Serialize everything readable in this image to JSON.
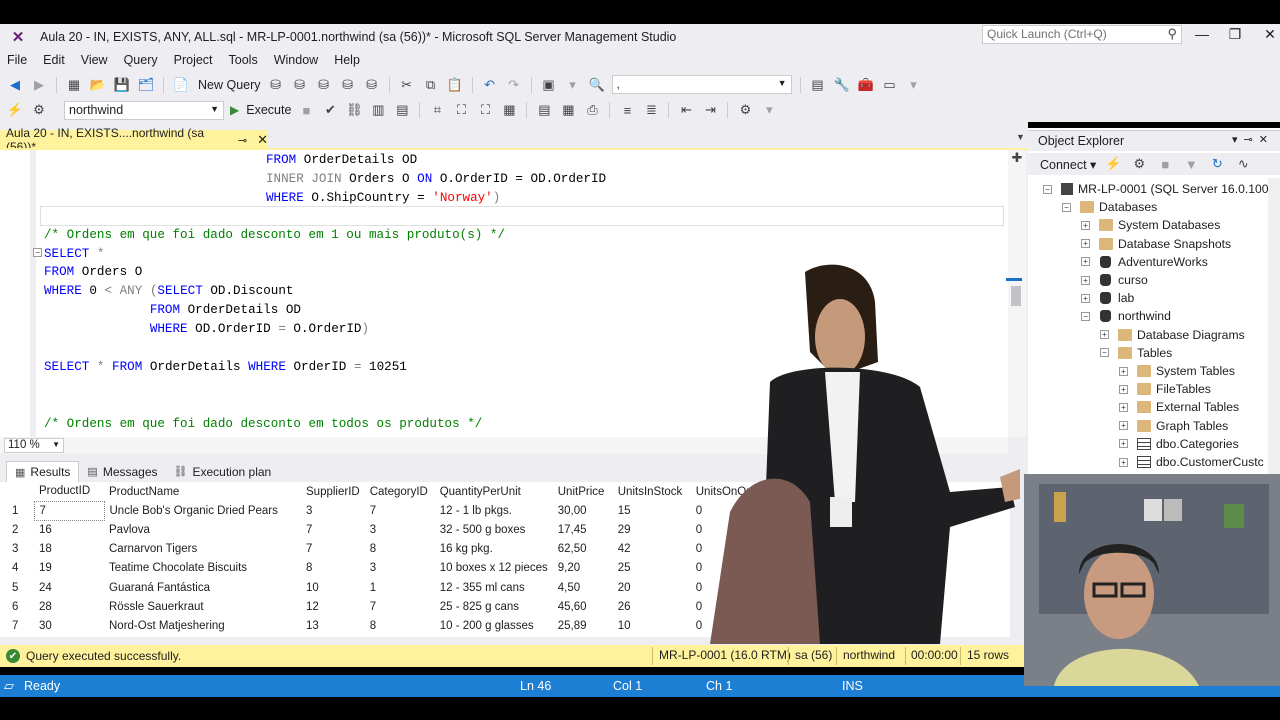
{
  "window": {
    "title": "Aula 20 - IN, EXISTS, ANY, ALL.sql - MR-LP-0001.northwind (sa (56))* - Microsoft SQL Server Management Studio",
    "quick_launch_placeholder": "Quick Launch (Ctrl+Q)"
  },
  "menu": [
    "File",
    "Edit",
    "View",
    "Query",
    "Project",
    "Tools",
    "Window",
    "Help"
  ],
  "toolbar": {
    "new_query_label": "New Query",
    "database": "northwind",
    "execute_label": "Execute",
    "search_combo_value": ","
  },
  "document_tab": {
    "label": "Aula 20 - IN, EXISTS....northwind (sa (56))*",
    "pin": "⊸",
    "close": "✕"
  },
  "editor": {
    "zoom": "110 %",
    "lines": [
      [
        "            ",
        [
          "kw",
          "FROM"
        ],
        " OrderDetails OD"
      ],
      [
        "            ",
        [
          "gr",
          "INNER JOIN"
        ],
        " Orders O ",
        [
          "kw",
          "ON"
        ],
        " O.OrderID = OD.OrderID"
      ],
      [
        "            ",
        [
          "kw",
          "WHERE"
        ],
        " O.ShipCountry = ",
        [
          "str",
          "'Norway'"
        ],
        [
          "gr",
          ")"
        ]
      ],
      [
        ""
      ],
      [
        [
          "cm",
          "/* Ordens em que foi dado desconto em 1 ou mais produto(s) */"
        ]
      ],
      [
        [
          "kw",
          "SELECT"
        ],
        " ",
        [
          "gr",
          "*"
        ]
      ],
      [
        [
          "kw",
          "FROM"
        ],
        " Orders O"
      ],
      [
        [
          "kw",
          "WHERE"
        ],
        " 0 ",
        [
          "gr",
          "<"
        ],
        " ",
        [
          "gr",
          "ANY"
        ],
        " ",
        [
          "gr",
          "("
        ],
        [
          "kw",
          "SELECT"
        ],
        " OD.Discount"
      ],
      [
        "              ",
        [
          "kw",
          "FROM"
        ],
        " OrderDetails OD"
      ],
      [
        "              ",
        [
          "kw",
          "WHERE"
        ],
        " OD.OrderID ",
        [
          "gr",
          "="
        ],
        " O.OrderID",
        [
          "gr",
          ")"
        ]
      ],
      [
        ""
      ],
      [
        [
          "kw",
          "SELECT"
        ],
        " ",
        [
          "gr",
          "*"
        ],
        " ",
        [
          "kw",
          "FROM"
        ],
        " OrderDetails ",
        [
          "kw",
          "WHERE"
        ],
        " OrderID ",
        [
          "gr",
          "="
        ],
        " 10251"
      ],
      [
        ""
      ],
      [
        ""
      ],
      [
        [
          "cm",
          "/* Ordens em que foi dado desconto em todos os produtos */"
        ]
      ]
    ]
  },
  "results": {
    "tabs": [
      "Results",
      "Messages",
      "Execution plan"
    ],
    "columns": [
      "ProductID",
      "ProductName",
      "SupplierID",
      "CategoryID",
      "QuantityPerUnit",
      "UnitPrice",
      "UnitsInStock",
      "UnitsOnOrder"
    ],
    "rows": [
      [
        "1",
        "7",
        "Uncle Bob's Organic Dried Pears",
        "3",
        "7",
        "12 - 1 lb pkgs.",
        "30,00",
        "15",
        "0"
      ],
      [
        "2",
        "16",
        "Pavlova",
        "7",
        "3",
        "32 - 500 g boxes",
        "17,45",
        "29",
        "0"
      ],
      [
        "3",
        "18",
        "Carnarvon Tigers",
        "7",
        "8",
        "16 kg pkg.",
        "62,50",
        "42",
        "0"
      ],
      [
        "4",
        "19",
        "Teatime Chocolate Biscuits",
        "8",
        "3",
        "10 boxes x 12 pieces",
        "9,20",
        "25",
        "0"
      ],
      [
        "5",
        "24",
        "Guaraná Fantástica",
        "10",
        "1",
        "12 - 355 ml cans",
        "4,50",
        "20",
        "0"
      ],
      [
        "6",
        "28",
        "Rössle Sauerkraut",
        "12",
        "7",
        "25 - 825 g cans",
        "45,60",
        "26",
        "0"
      ],
      [
        "7",
        "30",
        "Nord-Ost Matjeshering",
        "13",
        "8",
        "10 - 200 g glasses",
        "25,89",
        "10",
        "0"
      ]
    ]
  },
  "query_status": {
    "message": "Query executed successfully.",
    "server": "MR-LP-0001 (16.0 RTM)",
    "user": "sa (56)",
    "database": "northwind",
    "elapsed": "00:00:00",
    "rows": "15 rows"
  },
  "statusbar": {
    "state": "Ready",
    "line": "Ln 46",
    "col": "Col 1",
    "ch": "Ch 1",
    "mode": "INS"
  },
  "object_explorer": {
    "title": "Object Explorer",
    "connect_label": "Connect",
    "tree": [
      {
        "label": "MR-LP-0001 (SQL Server 16.0.1000",
        "level": 0,
        "icon": "server",
        "exp": "−"
      },
      {
        "label": "Databases",
        "level": 1,
        "icon": "folder",
        "exp": "−"
      },
      {
        "label": "System Databases",
        "level": 2,
        "icon": "folder",
        "exp": "+"
      },
      {
        "label": "Database Snapshots",
        "level": 2,
        "icon": "folder",
        "exp": "+"
      },
      {
        "label": "AdventureWorks",
        "level": 2,
        "icon": "db",
        "exp": "+"
      },
      {
        "label": "curso",
        "level": 2,
        "icon": "db",
        "exp": "+"
      },
      {
        "label": "lab",
        "level": 2,
        "icon": "db",
        "exp": "+"
      },
      {
        "label": "northwind",
        "level": 2,
        "icon": "db",
        "exp": "−"
      },
      {
        "label": "Database Diagrams",
        "level": 3,
        "icon": "folder",
        "exp": "+"
      },
      {
        "label": "Tables",
        "level": 3,
        "icon": "folder",
        "exp": "−"
      },
      {
        "label": "System Tables",
        "level": 4,
        "icon": "folder",
        "exp": "+"
      },
      {
        "label": "FileTables",
        "level": 4,
        "icon": "folder",
        "exp": "+"
      },
      {
        "label": "External Tables",
        "level": 4,
        "icon": "folder",
        "exp": "+"
      },
      {
        "label": "Graph Tables",
        "level": 4,
        "icon": "folder",
        "exp": "+"
      },
      {
        "label": "dbo.Categories",
        "level": 4,
        "icon": "table",
        "exp": "+"
      },
      {
        "label": "dbo.CustomerCustc",
        "level": 4,
        "icon": "table",
        "exp": "+"
      }
    ]
  },
  "colors": {
    "accent_blue": "#1c7fd4",
    "tab_yellow": "#fff29d",
    "keyword": "#0000ff",
    "comment": "#008000",
    "string": "#ff0000"
  }
}
